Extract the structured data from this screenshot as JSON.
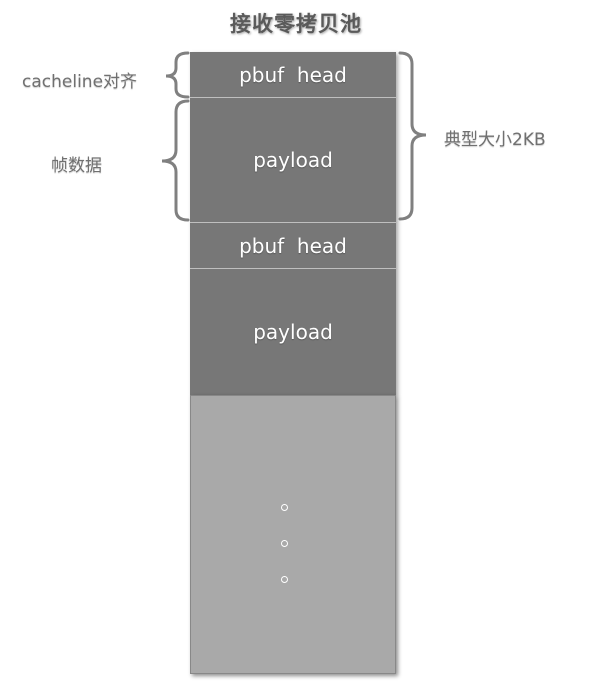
{
  "title": "接收零拷贝池",
  "blocks": [
    {
      "label": "pbuf  head"
    },
    {
      "label": "payload"
    },
    {
      "label": "pbuf  head"
    },
    {
      "label": "payload"
    }
  ],
  "annotations": {
    "cacheline": "cacheline对齐",
    "frame_data": "帧数据",
    "typical_size": "典型大小2KB"
  },
  "ellipsis_dots": 3,
  "colors": {
    "block_fill": "#777777",
    "pool_fill": "#a9a9a9",
    "brace_stroke": "#808080",
    "label_text": "#707070"
  }
}
